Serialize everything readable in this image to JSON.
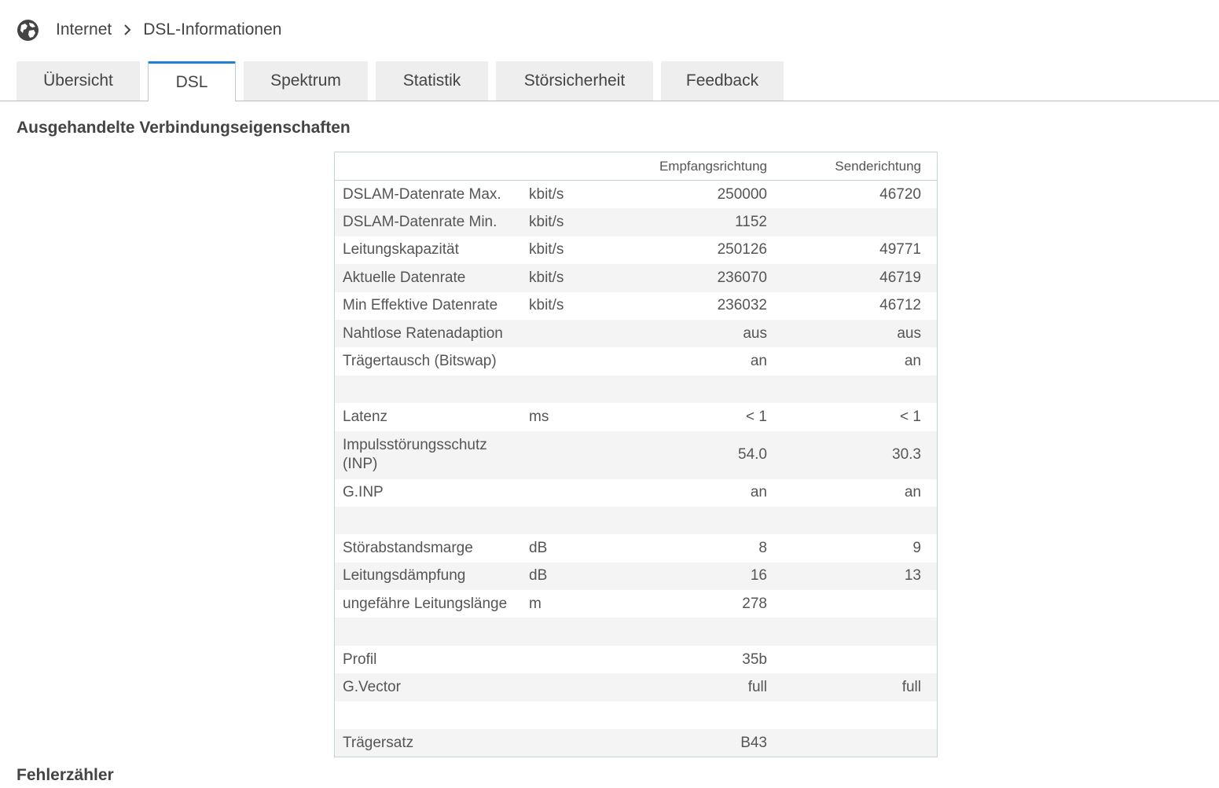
{
  "breadcrumb": {
    "root": "Internet",
    "current": "DSL-Informationen"
  },
  "tabs": [
    {
      "label": "Übersicht",
      "active": false
    },
    {
      "label": "DSL",
      "active": true
    },
    {
      "label": "Spektrum",
      "active": false
    },
    {
      "label": "Statistik",
      "active": false
    },
    {
      "label": "Störsicherheit",
      "active": false
    },
    {
      "label": "Feedback",
      "active": false
    }
  ],
  "section_title": "Ausgehandelte Verbindungseigenschaften",
  "table": {
    "headers": {
      "label": "",
      "unit": "",
      "down": "Empfangsrichtung",
      "up": "Senderichtung"
    },
    "rows": [
      {
        "label": "DSLAM-Datenrate Max.",
        "unit": "kbit/s",
        "down": "250000",
        "up": "46720"
      },
      {
        "label": "DSLAM-Datenrate Min.",
        "unit": "kbit/s",
        "down": "1152",
        "up": ""
      },
      {
        "label": "Leitungskapazität",
        "unit": "kbit/s",
        "down": "250126",
        "up": "49771"
      },
      {
        "label": "Aktuelle Datenrate",
        "unit": "kbit/s",
        "down": "236070",
        "up": "46719"
      },
      {
        "label": "Min Effektive Datenrate",
        "unit": "kbit/s",
        "down": "236032",
        "up": "46712"
      },
      {
        "label": "Nahtlose Ratenadaption",
        "unit": "",
        "down": "aus",
        "up": "aus"
      },
      {
        "label": "Trägertausch (Bitswap)",
        "unit": "",
        "down": "an",
        "up": "an"
      },
      {
        "label": "",
        "unit": "",
        "down": "",
        "up": ""
      },
      {
        "label": "Latenz",
        "unit": "ms",
        "down": "< 1",
        "up": "< 1"
      },
      {
        "label": "Impulsstörungsschutz (INP)",
        "unit": "",
        "down": "54.0",
        "up": "30.3"
      },
      {
        "label": "G.INP",
        "unit": "",
        "down": "an",
        "up": "an"
      },
      {
        "label": "",
        "unit": "",
        "down": "",
        "up": ""
      },
      {
        "label": "Störabstandsmarge",
        "unit": "dB",
        "down": "8",
        "up": "9"
      },
      {
        "label": "Leitungsdämpfung",
        "unit": "dB",
        "down": "16",
        "up": "13"
      },
      {
        "label": "ungefähre Leitungslänge",
        "unit": "m",
        "down": "278",
        "up": ""
      },
      {
        "label": "",
        "unit": "",
        "down": "",
        "up": ""
      },
      {
        "label": "Profil",
        "unit": "",
        "down": "35b",
        "up": ""
      },
      {
        "label": "G.Vector",
        "unit": "",
        "down": "full",
        "up": "full"
      },
      {
        "label": "",
        "unit": "",
        "down": "",
        "up": ""
      },
      {
        "label": "Trägersatz",
        "unit": "",
        "down": "B43",
        "up": ""
      }
    ]
  },
  "error_section_title": "Fehlerzähler",
  "icons": {
    "breadcrumb": "globe-icon",
    "separator": "chevron-right-icon"
  },
  "colors": {
    "active_tab_accent": "#1f7fd4",
    "tab_bg": "#eeeeee",
    "row_alt": "#f4f4f4"
  }
}
